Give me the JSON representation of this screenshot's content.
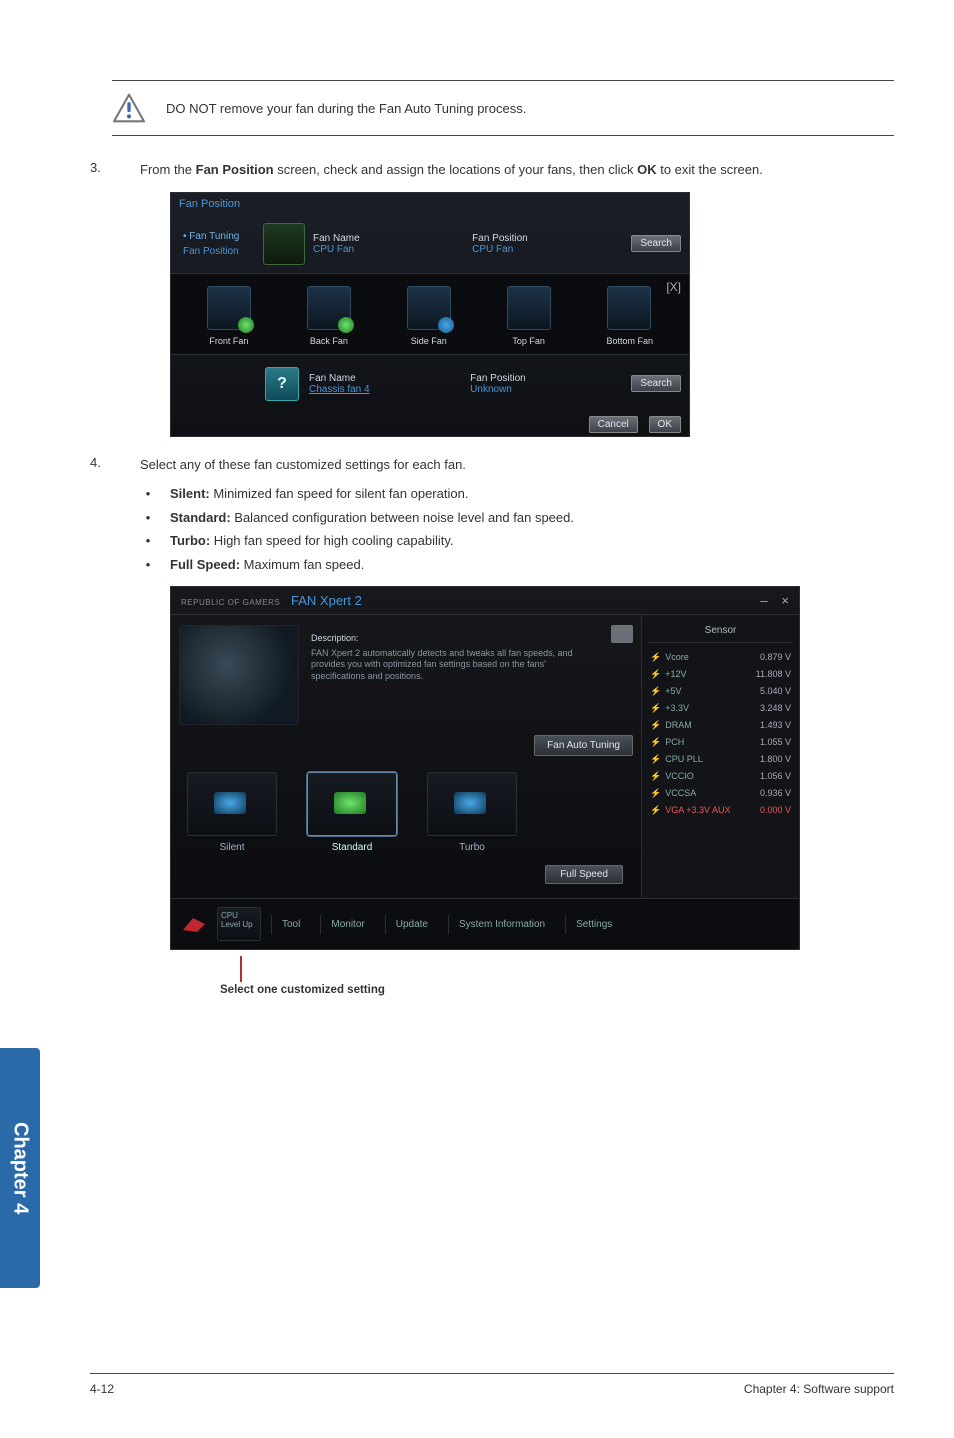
{
  "note": {
    "text": "DO NOT remove your fan during the Fan Auto Tuning process."
  },
  "step3": {
    "num": "3.",
    "prefix": "From the ",
    "bold1": "Fan Position",
    "mid": " screen, check and assign the locations of your fans, then click ",
    "bold2": "OK",
    "suffix": " to exit the screen."
  },
  "shot1": {
    "title": "Fan Position",
    "side": {
      "tuning": "• Fan Tuning",
      "fanpos": "Fan Position"
    },
    "a": {
      "name_lbl": "Fan Name",
      "name_val": "CPU Fan",
      "pos_lbl": "Fan Position",
      "pos_val": "CPU Fan",
      "search": "Search"
    },
    "close": "[X]",
    "fans": {
      "f1": "Front Fan",
      "f2": "Back Fan",
      "f3": "Side Fan",
      "f4": "Top Fan",
      "f5": "Bottom Fan"
    },
    "b": {
      "name_lbl": "Fan Name",
      "name_val": "Chassis fan 4",
      "pos_lbl": "Fan Position",
      "pos_val": "Unknown",
      "search": "Search"
    },
    "cancel": "Cancel",
    "ok": "OK"
  },
  "step4": {
    "num": "4.",
    "text": "Select any of these fan customized settings for each fan."
  },
  "bullets": {
    "silent": {
      "label": "Silent:",
      "desc": " Minimized fan speed for silent fan operation."
    },
    "standard": {
      "label": "Standard:",
      "desc": " Balanced configuration between noise level and fan speed."
    },
    "turbo": {
      "label": "Turbo:",
      "desc": " High fan speed for high cooling capability."
    },
    "full": {
      "label": "Full Speed:",
      "desc": " Maximum fan speed."
    }
  },
  "shot2": {
    "rog": "REPUBLIC OF GAMERS",
    "title": "FAN Xpert 2",
    "minus": "–",
    "x": "×",
    "desc": {
      "hdr": "Description:",
      "body": "FAN Xpert 2 automatically detects and tweaks all fan speeds, and provides you with optimized fan settings based on the fans' specifications and positions."
    },
    "auto_btn": "Fan Auto Tuning",
    "presets": {
      "silent": "Silent",
      "standard": "Standard",
      "turbo": "Turbo"
    },
    "fullspeed": "Full Speed",
    "sensor": {
      "hdr": "Sensor",
      "rows": [
        {
          "k": "Vcore",
          "v": "0.879 V"
        },
        {
          "k": "+12V",
          "v": "11.808 V"
        },
        {
          "k": "+5V",
          "v": "5.040 V"
        },
        {
          "k": "+3.3V",
          "v": "3.248 V"
        },
        {
          "k": "DRAM",
          "v": "1.493 V"
        },
        {
          "k": "PCH",
          "v": "1.055 V"
        },
        {
          "k": "CPU PLL",
          "v": "1.800 V"
        },
        {
          "k": "VCCIO",
          "v": "1.056 V"
        },
        {
          "k": "VCCSA",
          "v": "0.936 V"
        }
      ],
      "warn": {
        "k": "VGA +3.3V AUX",
        "v": "0.000 V"
      }
    },
    "strip": {
      "mini": "CPU Level Up",
      "t1": "Tool",
      "t2": "Monitor",
      "t3": "Update",
      "t4": "System Information",
      "t5": "Settings"
    }
  },
  "callout": "Select one customized setting",
  "sidetab": "Chapter 4",
  "footer": {
    "left": "4-12",
    "right": "Chapter 4: Software support"
  }
}
